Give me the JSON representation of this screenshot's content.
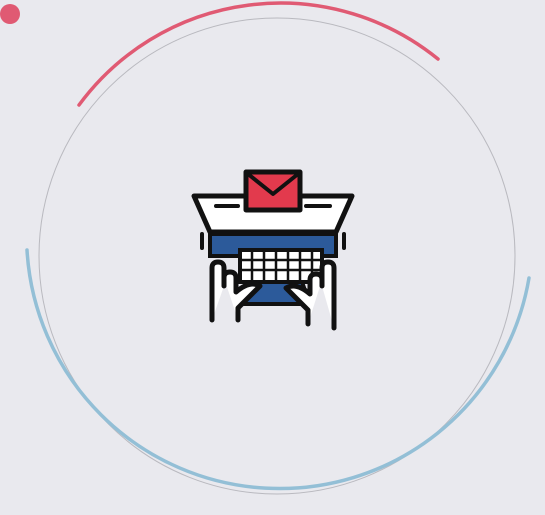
{
  "colors": {
    "background": "#e9e9ee",
    "accent_red": "#e05a73",
    "accent_blue": "#93bfd6",
    "inner_ring": "#b9b9bf",
    "icon_outline": "#111111",
    "icon_envelope": "#e23a4d",
    "icon_keyboard": "#2c5a9a",
    "icon_white": "#ffffff"
  },
  "icons": {
    "main": "laptop-typing-email-icon",
    "corner": "record-dot-icon"
  }
}
